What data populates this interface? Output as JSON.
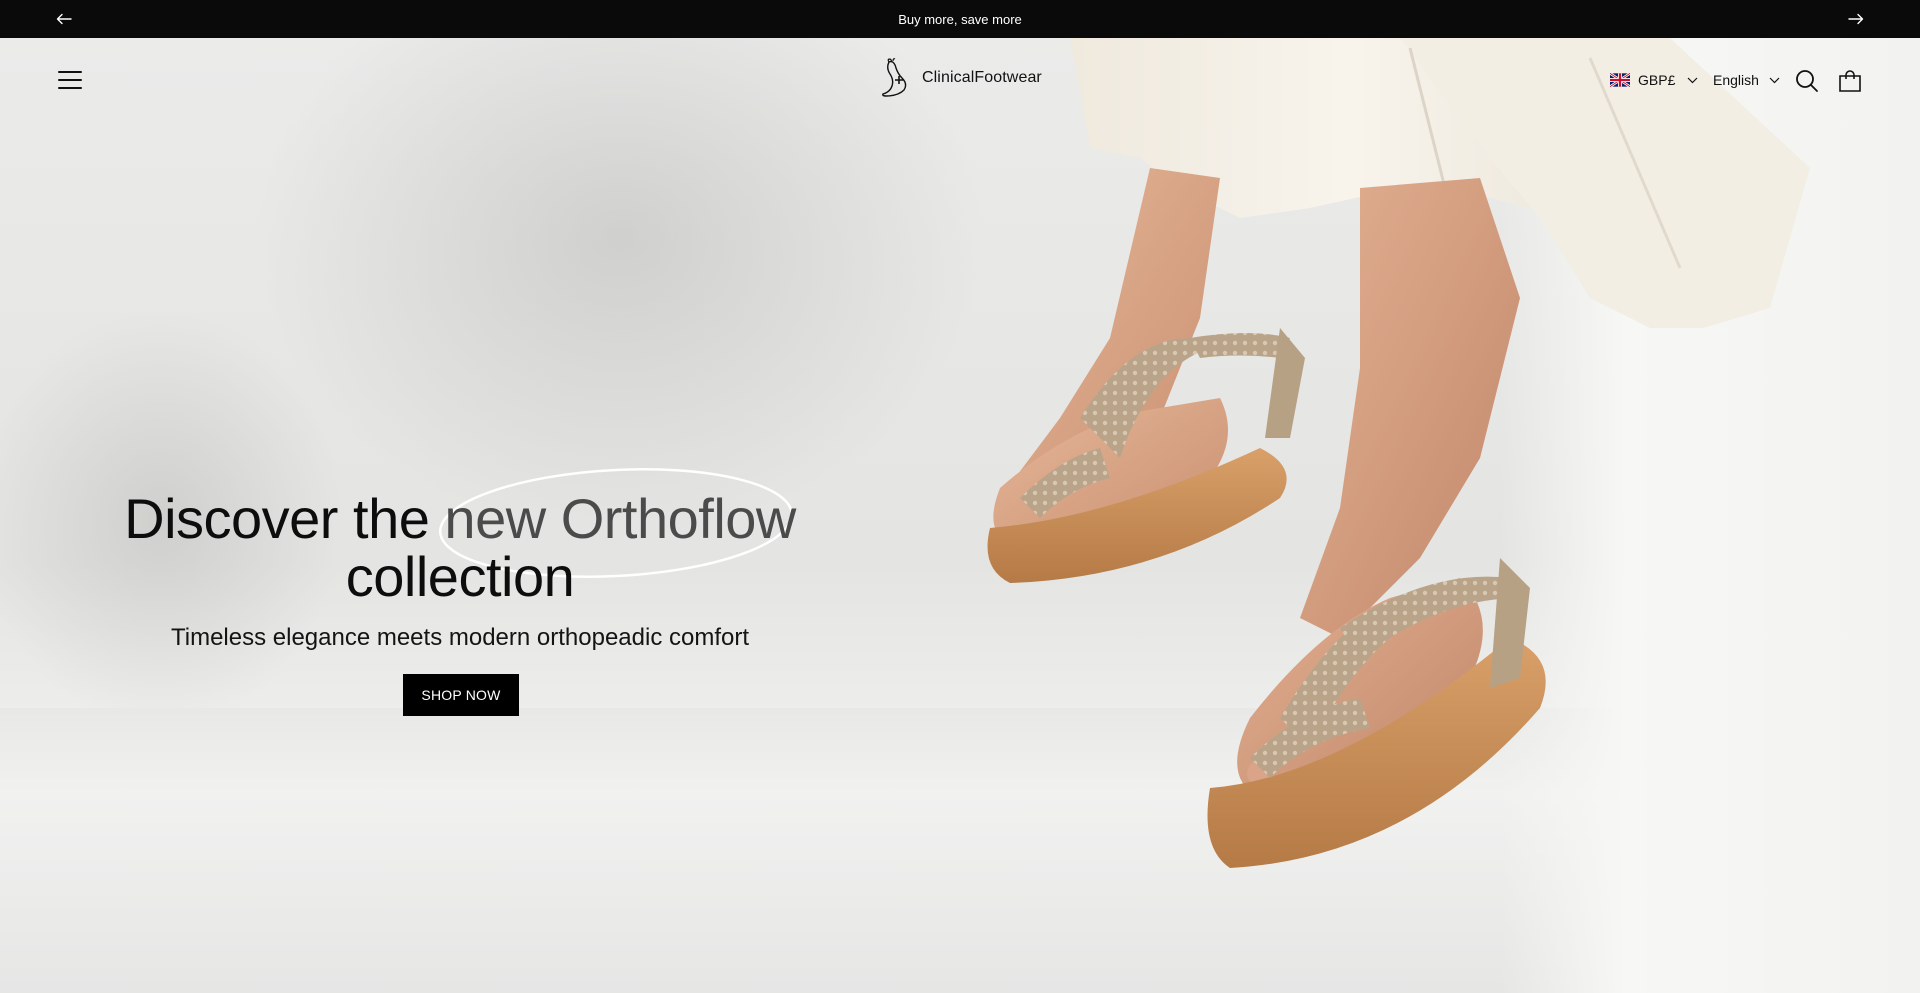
{
  "announcement": {
    "text": "Buy more, save more",
    "prev_icon": "arrow-left-icon",
    "next_icon": "arrow-right-icon"
  },
  "header": {
    "logo_text": "ClinicalFootwear",
    "currency": "GBP£",
    "language": "English",
    "icons": {
      "menu": "menu-icon",
      "search": "search-icon",
      "cart": "cart-icon",
      "flag": "uk-flag-icon"
    }
  },
  "hero": {
    "headline_part1": "Discover the ",
    "headline_accent": "new Orthoflow",
    "headline_part2": "collection",
    "subheadline": "Timeless elegance meets modern orthopeadic comfort",
    "cta_label": "SHOP NOW"
  },
  "colors": {
    "announcement_bg": "#0a0a0a",
    "cta_bg": "#000000",
    "accent_text": "#4b4b4b",
    "hero_bg": "#ececea"
  }
}
